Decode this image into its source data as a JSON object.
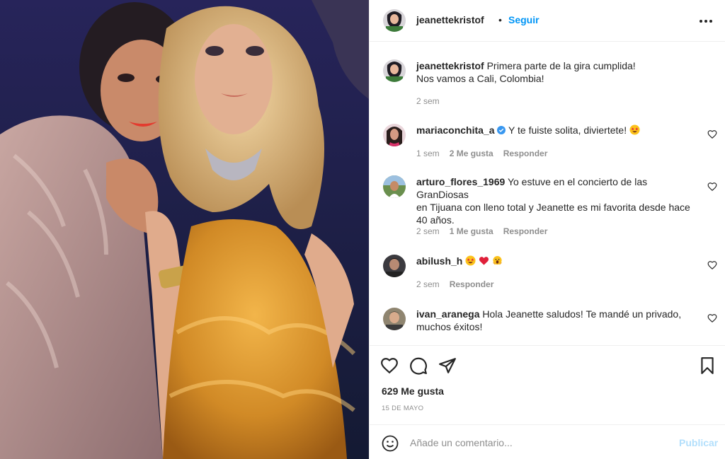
{
  "post": {
    "author": "jeanettekristof",
    "dot": "•",
    "follow_label": "Seguir",
    "caption_user": "jeanettekristof",
    "caption_lines": [
      "Primera parte de la gira cumplida!",
      "Nos vamos a Cali, Colombia!"
    ],
    "caption_time": "2 sem"
  },
  "comments": [
    {
      "user": "mariaconchita_a",
      "verified": true,
      "text": "Y te fuiste solita, diviertete!",
      "emojis": [
        "star-struck-emoji"
      ],
      "time": "1 sem",
      "likes": "2 Me gusta",
      "reply": "Responder"
    },
    {
      "user": "arturo_flores_1969",
      "text_lines": [
        "Yo estuve en el concierto de las GranDiosas",
        "en Tijuana con lleno total y Jeanette es mi favorita desde hace",
        "40 años."
      ],
      "time": "2 sem",
      "likes": "1 Me gusta",
      "reply": "Responder"
    },
    {
      "user": "abilush_h",
      "emojis": [
        "star-struck-emoji",
        "red-heart-emoji",
        "face-screaming-emoji"
      ],
      "time": "2 sem",
      "reply": "Responder"
    },
    {
      "user": "ivan_aranega",
      "text_lines": [
        "Hola Jeanette saludos! Te mandé un privado,",
        "muchos éxitos!"
      ]
    }
  ],
  "footer": {
    "likes": "629 Me gusta",
    "date": "15 DE MAYO",
    "comment_placeholder": "Añade un comentario...",
    "publish_label": "Publicar"
  },
  "colors": {
    "link_blue": "#0095f6",
    "publish_disabled": "#b2dffc",
    "meta_gray": "#8e8e8e",
    "divider": "#efefef"
  }
}
